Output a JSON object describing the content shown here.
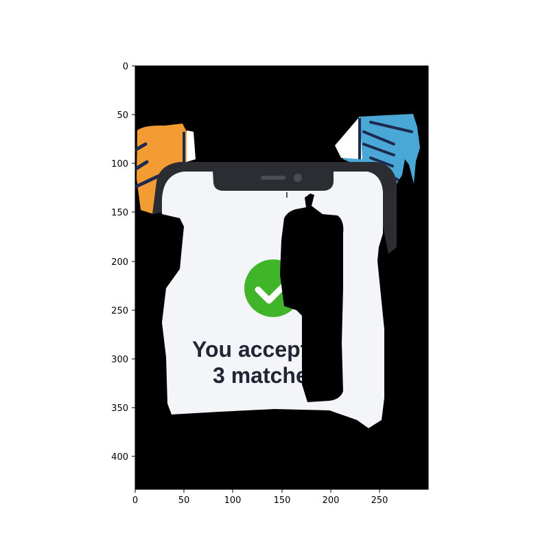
{
  "axes": {
    "x_ticks": [
      "0",
      "50",
      "100",
      "150",
      "200",
      "250"
    ],
    "y_ticks": [
      "0",
      "50",
      "100",
      "150",
      "200",
      "250",
      "300",
      "350",
      "400"
    ]
  },
  "image": {
    "headline_line1": "You accepted",
    "headline_line2": "3 matches",
    "check_icon": "check-circle-icon",
    "colors": {
      "background": "#000000",
      "screen": "#f4f5f9",
      "phone_frame": "#2b2d33",
      "check": "#41b52a",
      "text": "#222634",
      "orange_accent": "#f39c33",
      "blue_accent": "#4aa8d6",
      "stripe": "#1f2a4f"
    }
  }
}
